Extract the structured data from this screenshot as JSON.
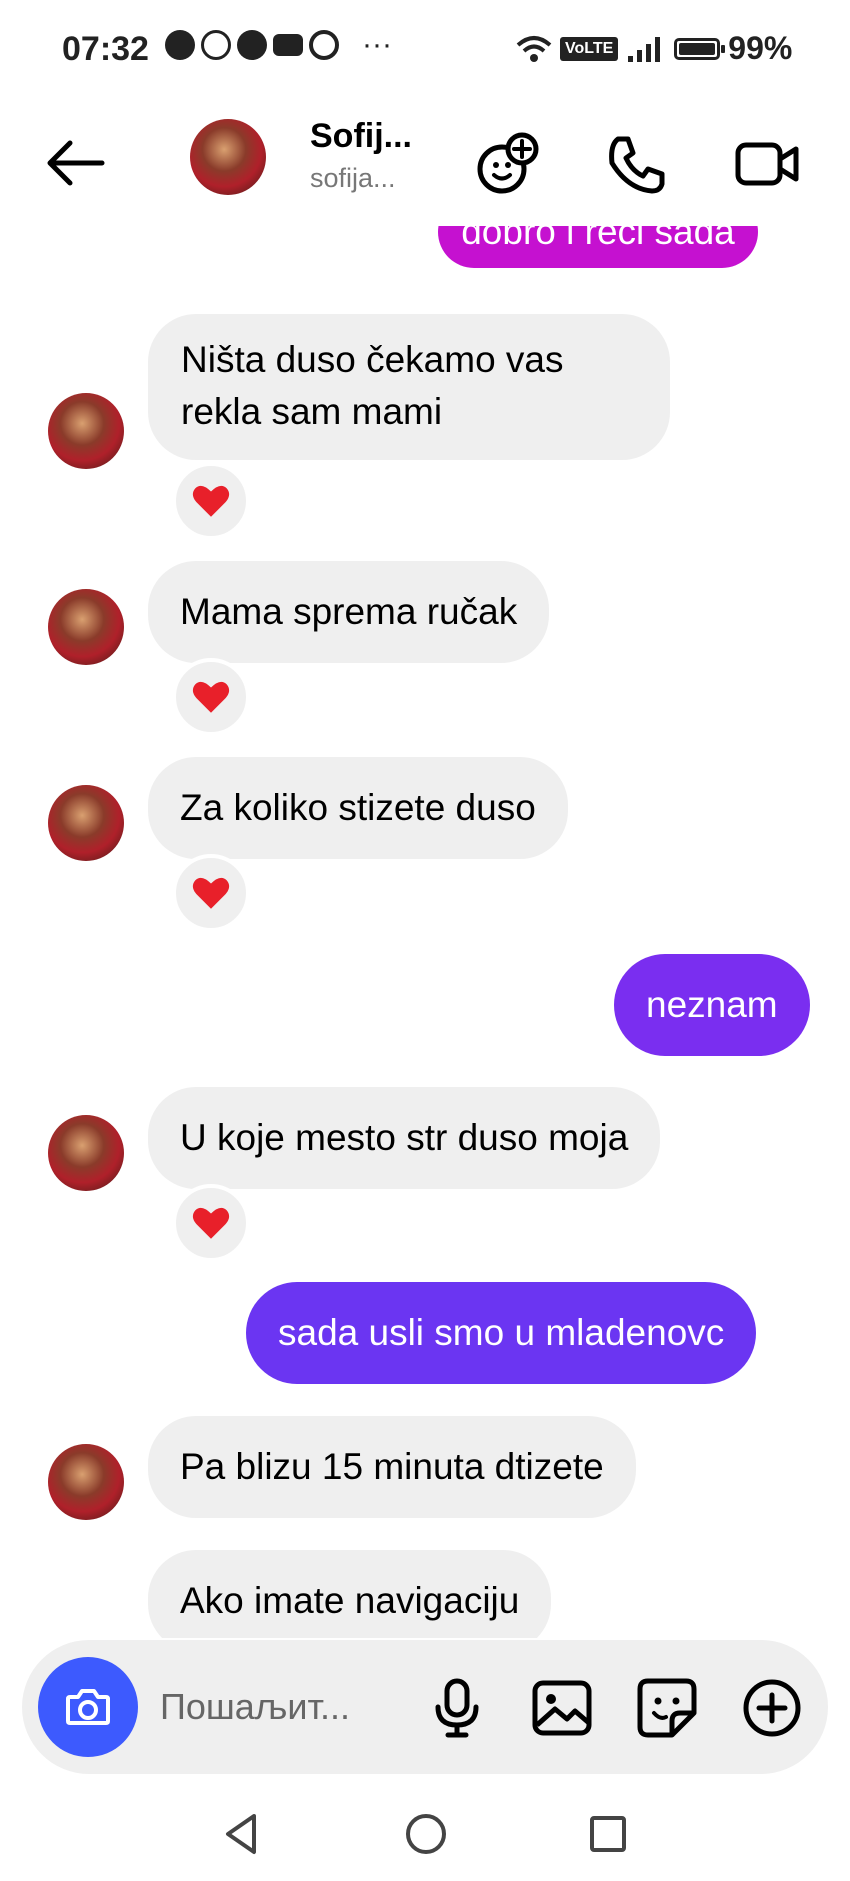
{
  "status_bar": {
    "time": "07:32",
    "dots": "···",
    "volte": "VoLTE",
    "battery_percent": "99%",
    "battery_level": 0.99,
    "app_icons": [
      "chat-bubble-icon",
      "viber-icon",
      "facebook-icon",
      "youtube-icon",
      "chrome-icon"
    ]
  },
  "header": {
    "name": "Sofij...",
    "username": "sofija...",
    "icons": [
      "back-arrow-icon",
      "effects-icon",
      "phone-icon",
      "video-icon"
    ]
  },
  "messages": [
    {
      "id": "m0",
      "direction": "out",
      "text": "dobro i reci sada",
      "color": "#c511d0",
      "partial": true
    },
    {
      "id": "m1",
      "direction": "in",
      "lines": [
        "Ništa duso čekamo vas",
        "rekla sam mami"
      ],
      "reaction": "heart"
    },
    {
      "id": "m2",
      "direction": "in",
      "text": "Mama sprema ručak",
      "reaction": "heart"
    },
    {
      "id": "m3",
      "direction": "in",
      "text": "Za koliko stizete duso",
      "reaction": "heart"
    },
    {
      "id": "m4",
      "direction": "out",
      "text": "neznam",
      "color": "#7a2ef0"
    },
    {
      "id": "m5",
      "direction": "in",
      "text": "U koje mesto str duso moja",
      "reaction": "heart"
    },
    {
      "id": "m6",
      "direction": "out",
      "text": "sada usli smo u mladenovc",
      "color": "#6b35f2"
    },
    {
      "id": "m7",
      "direction": "in",
      "text": "Pa blizu 15 minuta dtizete"
    },
    {
      "id": "m8",
      "direction": "in",
      "text": "Ako imate navigaciju"
    }
  ],
  "colors": {
    "incoming_bubble": "#efefef",
    "reaction_heart": "#e8202a",
    "camera_button": "#3d5afe"
  },
  "composer": {
    "placeholder": "Пошаљит...",
    "icons": [
      "camera-icon",
      "microphone-icon",
      "gallery-icon",
      "sticker-icon",
      "plus-icon"
    ]
  },
  "nav_bar": {
    "icons": [
      "nav-back-icon",
      "nav-home-icon",
      "nav-recents-icon"
    ]
  }
}
